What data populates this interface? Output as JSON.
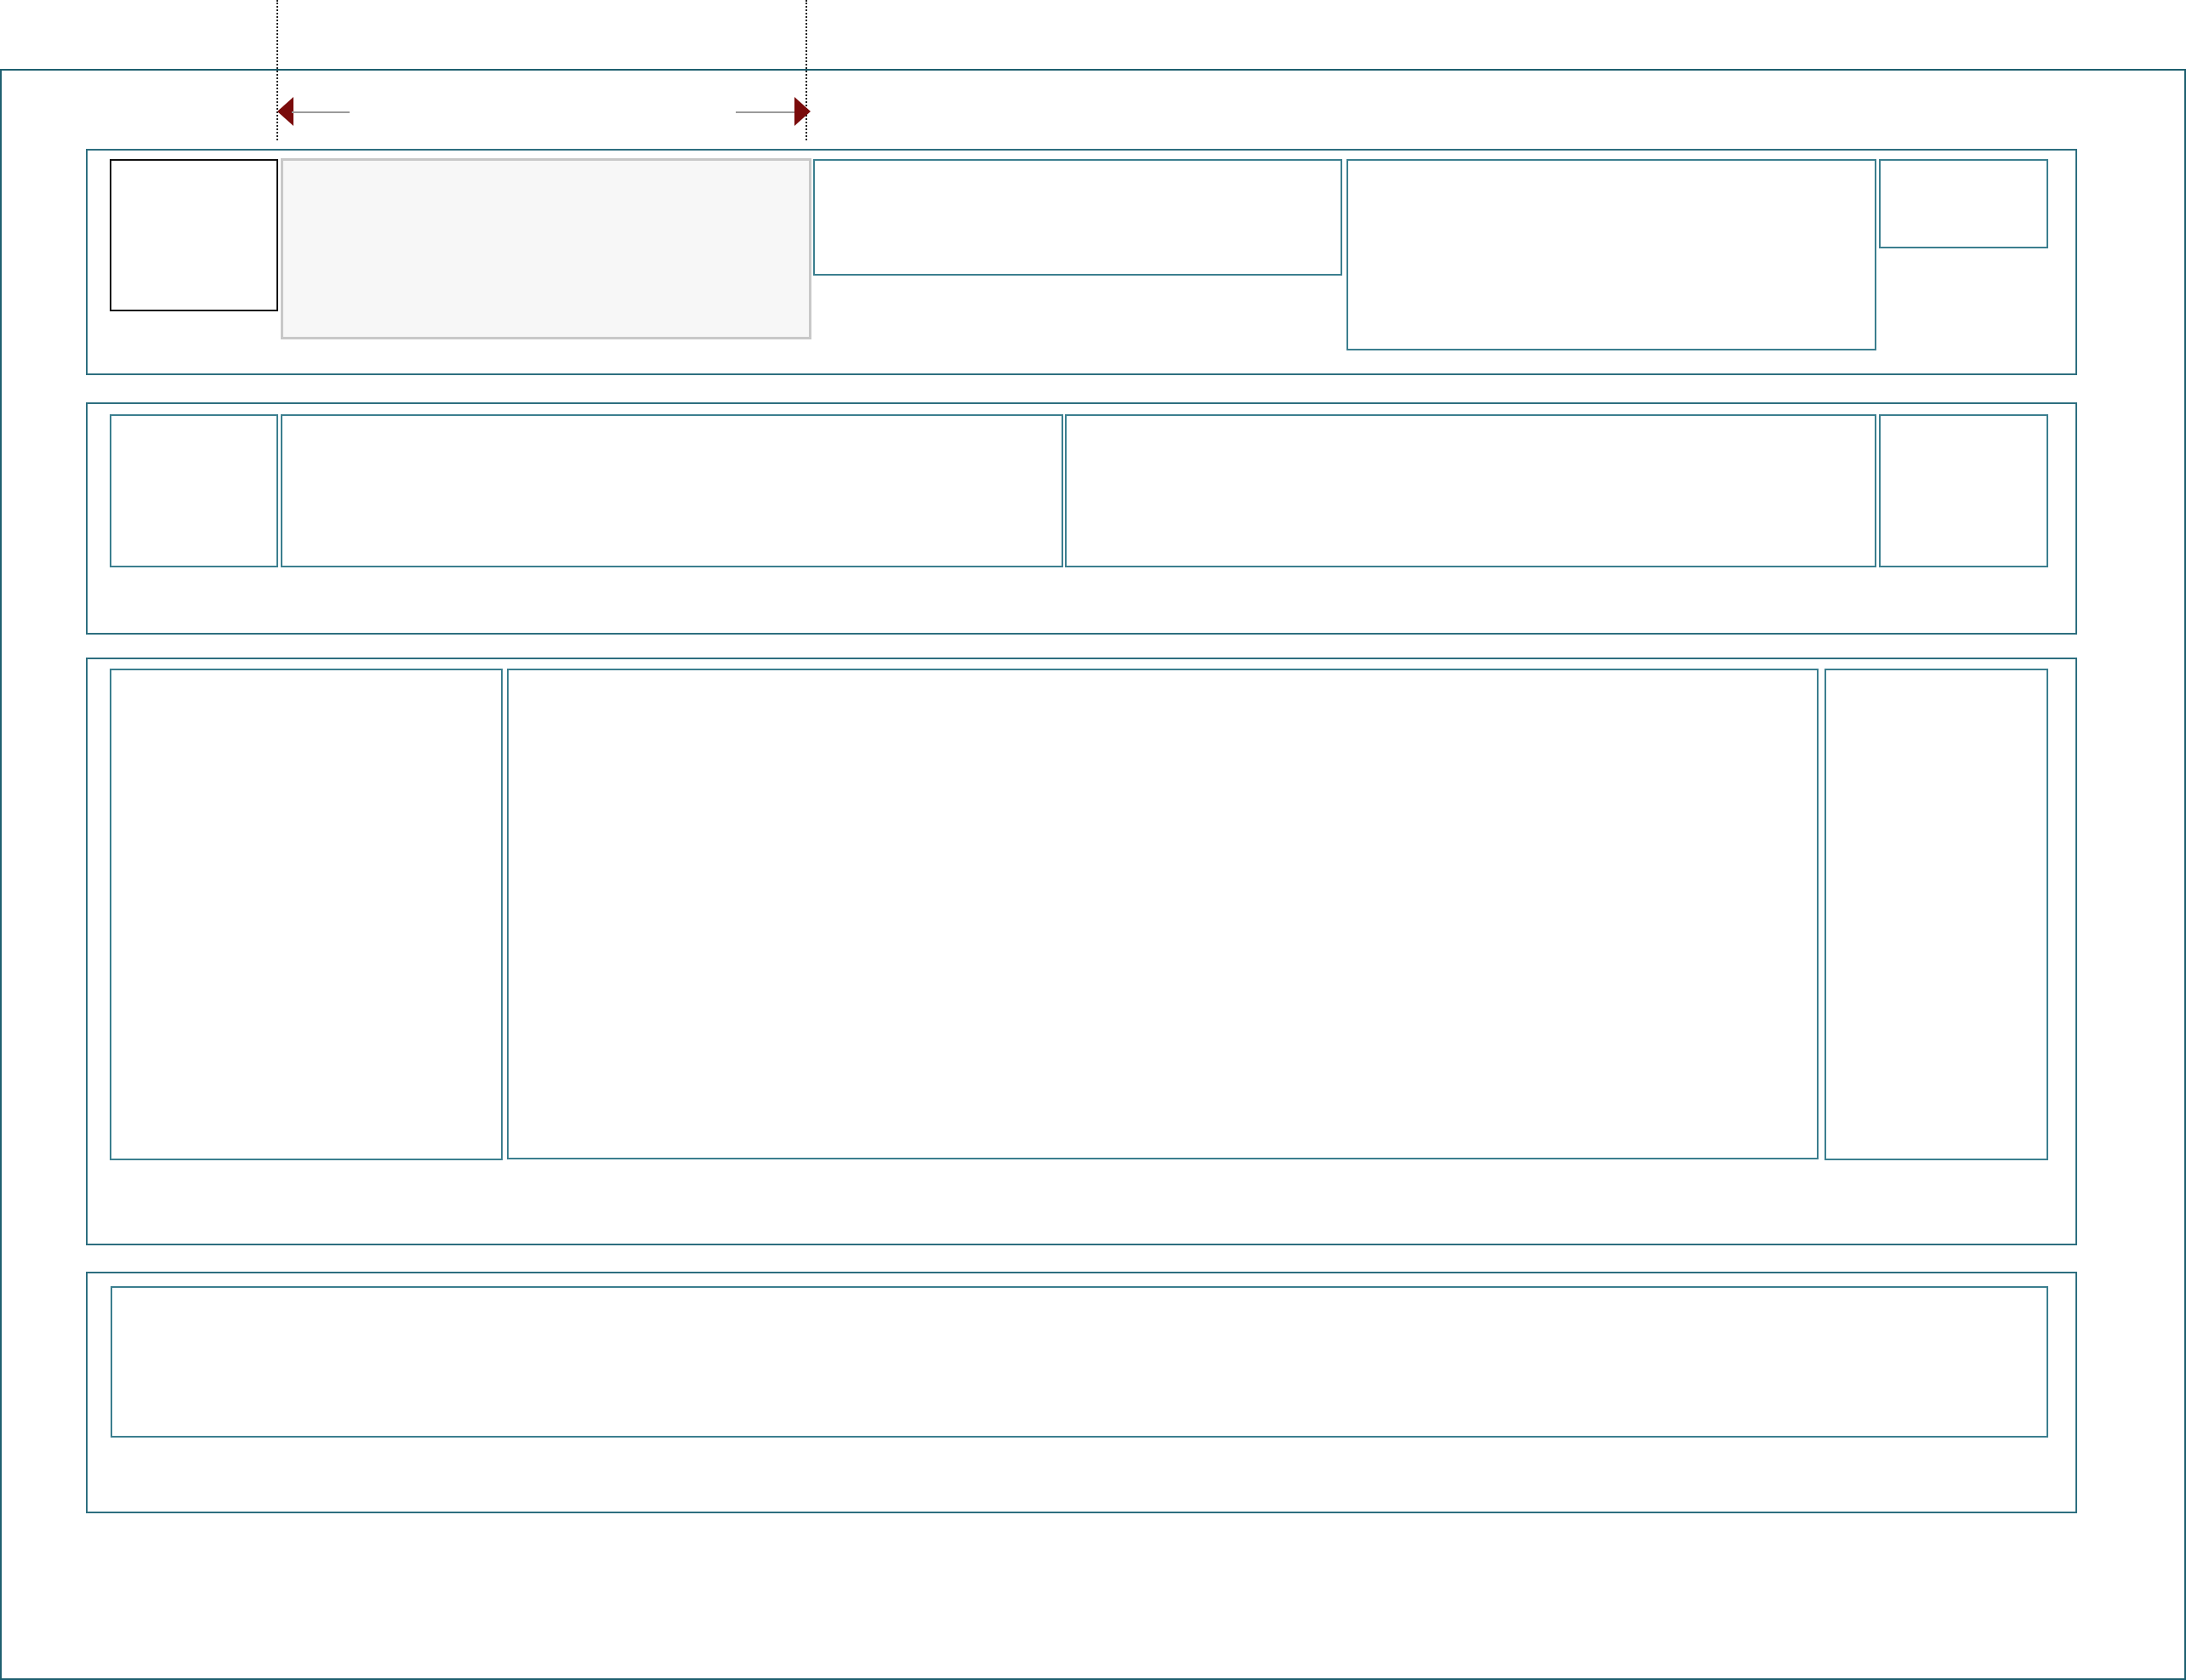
{
  "diagram": {
    "colors": {
      "frame_border": "#1f6070",
      "row_border": "#2e6f80",
      "cell_border": "#3c7f8f",
      "highlight_border": "#111111",
      "selected_fill": "#f7f7f7",
      "selected_border": "#c8c8c8",
      "arrow_head": "#7a0b0b",
      "arrow_line": "#9a9a9a"
    },
    "rows": [
      {
        "cells": 5,
        "selected_cell": 2,
        "highlighted_cell": 1
      },
      {
        "cells": 4
      },
      {
        "cells": 3
      },
      {
        "cells": 1
      }
    ],
    "resize_indicator": {
      "icons": [
        "arrow-left-icon",
        "arrow-right-icon"
      ]
    }
  }
}
